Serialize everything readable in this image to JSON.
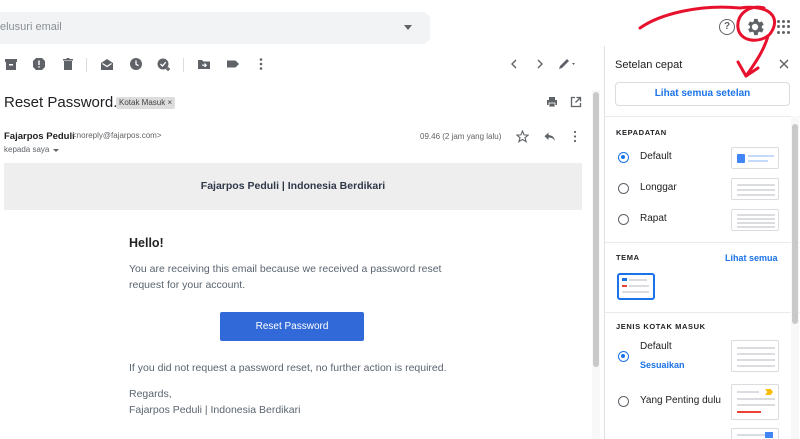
{
  "search": {
    "placeholder": "elusuri email"
  },
  "header": {
    "help_icon": "help-icon",
    "settings_icon": "gear-icon",
    "apps_icon": "apps-grid-icon"
  },
  "toolbar": {
    "icons": [
      "archive-icon",
      "report-spam-icon",
      "delete-icon",
      "mark-unread-icon",
      "snooze-icon",
      "add-task-icon",
      "move-to-icon",
      "label-icon",
      "more-icon",
      "prev-icon",
      "next-icon",
      "input-tools-icon"
    ]
  },
  "email": {
    "subject": "Reset Password.",
    "label": "Kotak Masuk ×",
    "sender_name": "Fajarpos Peduli",
    "sender_email": "<noreply@fajarpos.com>",
    "recipient": "kepada saya",
    "time": "09.46 (2 jam yang lalu)",
    "banner_title": "Fajarpos Peduli | Indonesia Berdikari",
    "greeting": "Hello!",
    "intro": "You are receiving this email because we received a password reset request for your account.",
    "button_label": "Reset Password",
    "outro": "If you did not request a password reset, no further action is required.",
    "regards": "Regards,",
    "signature": "Fajarpos Peduli | Indonesia Berdikari"
  },
  "quick_settings": {
    "title": "Setelan cepat",
    "see_all": "Lihat semua setelan",
    "density_label": "KEPADATAN",
    "density_options": [
      {
        "label": "Default",
        "selected": true
      },
      {
        "label": "Longgar",
        "selected": false
      },
      {
        "label": "Rapat",
        "selected": false
      }
    ],
    "theme_label": "TEMA",
    "theme_view_all": "Lihat semua",
    "inbox_type_label": "JENIS KOTAK MASUK",
    "inbox_options": [
      {
        "label": "Default",
        "selected": true,
        "sub_link": "Sesuaikan"
      },
      {
        "label": "Yang Penting dulu",
        "selected": false
      }
    ]
  },
  "colors": {
    "accent": "#1a73e8",
    "button": "#3169d8",
    "annotation": "#e8112d"
  }
}
